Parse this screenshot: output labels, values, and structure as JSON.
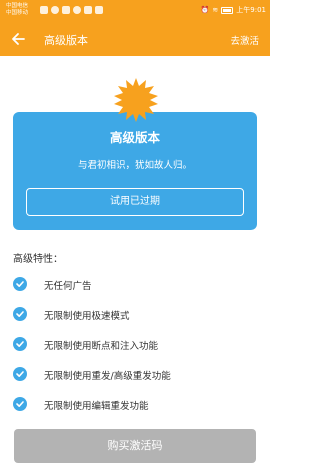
{
  "statusbar": {
    "carrier_line1": "中国电信",
    "carrier_line2": "中国移动",
    "battery": "",
    "time": "上午9:01"
  },
  "appbar": {
    "title": "高级版本",
    "action_label": "去激活"
  },
  "card": {
    "title": "高级版本",
    "subtitle": "与君初相识，犹如故人归。",
    "status_button": "试用已过期"
  },
  "features": {
    "heading": "高级特性：",
    "items": [
      "无任何广告",
      "无限制使用极速模式",
      "无限制使用断点和注入功能",
      "无限制使用重发/高级重发功能",
      "无限制使用编辑重发功能"
    ]
  },
  "buy_button": "购买激活码",
  "colors": {
    "accent": "#f7a11e",
    "card": "#3ea8e6",
    "button_disabled": "#b3b3b3"
  }
}
